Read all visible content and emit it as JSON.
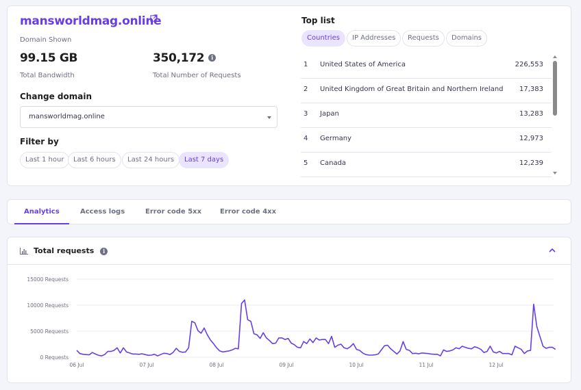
{
  "header": {
    "domain": "mansworldmag.online",
    "domain_caption": "Domain Shown",
    "bandwidth_value": "99.15 GB",
    "bandwidth_label": "Total Bandwidth",
    "requests_value": "350,172",
    "requests_label": "Total Number of Requests"
  },
  "change_domain": {
    "label": "Change domain",
    "selected": "mansworldmag.online"
  },
  "filter": {
    "label": "Filter by",
    "options": [
      "Last 1 hour",
      "Last 6 hours",
      "Last 24 hours",
      "Last 7 days"
    ],
    "active": "Last 7 days"
  },
  "top_list": {
    "title": "Top list",
    "tabs": [
      "Countries",
      "IP Addresses",
      "Requests",
      "Domains"
    ],
    "active_tab": "Countries",
    "rows": [
      {
        "rank": "1",
        "name": "United States of America",
        "value": "226,553"
      },
      {
        "rank": "2",
        "name": "United Kingdom of Great Britain and Northern Ireland",
        "value": "17,383"
      },
      {
        "rank": "3",
        "name": "Japan",
        "value": "13,283"
      },
      {
        "rank": "4",
        "name": "Germany",
        "value": "12,973"
      },
      {
        "rank": "5",
        "name": "Canada",
        "value": "12,239"
      }
    ]
  },
  "tabs": {
    "items": [
      "Analytics",
      "Access logs",
      "Error code 5xx",
      "Error code 4xx"
    ],
    "active": "Analytics"
  },
  "chart_panel": {
    "title": "Total requests",
    "info": "i"
  },
  "colors": {
    "accent": "#673de6",
    "accent_light": "#ebe4ff",
    "text_dark": "#1d1e20",
    "muted": "#6d7081"
  },
  "chart_data": {
    "type": "line",
    "title": "Total requests",
    "xlabel": "",
    "ylabel": "",
    "ylim": [
      0,
      15000
    ],
    "y_ticks": [
      {
        "value": 0,
        "label": "0 Requests"
      },
      {
        "value": 5000,
        "label": "5000 Requests"
      },
      {
        "value": 10000,
        "label": "10000 Requests"
      },
      {
        "value": 15000,
        "label": "15000 Requests"
      }
    ],
    "x_ticks": [
      "06 Jul",
      "07 Jul",
      "08 Jul",
      "09 Jul",
      "10 Jul",
      "11 Jul",
      "12 Jul"
    ],
    "x_unit": "days since 06 Jul",
    "xlim": [
      0,
      6.85
    ],
    "grid": true,
    "series": [
      {
        "name": "Requests",
        "color": "#673de6",
        "x_step_days": 0.0833,
        "values": [
          1300,
          700,
          550,
          500,
          450,
          900,
          600,
          350,
          250,
          500,
          1100,
          1100,
          1300,
          1800,
          800,
          1800,
          1000,
          800,
          600,
          600,
          550,
          650,
          500,
          350,
          400,
          550,
          250,
          500,
          750,
          700,
          500,
          900,
          1700,
          1100,
          950,
          1000,
          1800,
          6900,
          6600,
          5100,
          4600,
          5600,
          4300,
          3300,
          2600,
          1800,
          1200,
          1000,
          1100,
          1200,
          1400,
          1700,
          1600,
          10300,
          11000,
          7200,
          6900,
          4500,
          4300,
          3600,
          4700,
          3700,
          3200,
          2600,
          2700,
          3700,
          3700,
          3400,
          3600,
          2700,
          2400,
          1900,
          1800,
          3000,
          2600,
          3500,
          2800,
          3700,
          3300,
          3400,
          3400,
          2600,
          4000,
          1900,
          2300,
          2500,
          1800,
          1600,
          2000,
          2600,
          1500,
          1300,
          800,
          500,
          400,
          400,
          450,
          600,
          1400,
          2200,
          2300,
          1600,
          1100,
          600,
          1200,
          3000,
          1500,
          1300,
          700,
          750,
          650,
          800,
          750,
          700,
          600,
          550,
          550,
          250,
          1400,
          1100,
          1200,
          1400,
          1800,
          1600,
          2100,
          1900,
          1700,
          1600,
          2000,
          1800,
          1500,
          900,
          1100,
          2100,
          1000,
          800,
          1100,
          700,
          700,
          700,
          450,
          2100,
          1800,
          1500,
          700,
          1200,
          1300,
          10200,
          5900,
          4000,
          2100,
          1700,
          1900,
          1900,
          1500
        ]
      }
    ]
  }
}
